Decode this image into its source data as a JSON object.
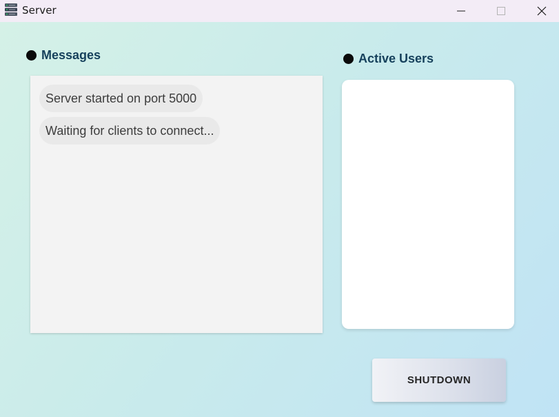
{
  "window": {
    "title": "Server",
    "app_icon": "server-rack-icon",
    "controls": {
      "minimize_icon": "minimize-icon",
      "maximize_icon": "maximize-icon",
      "close_icon": "close-icon"
    }
  },
  "messages": {
    "header": "Messages",
    "items": [
      {
        "text": "Server started on port 5000"
      },
      {
        "text": "Waiting for clients to connect..."
      }
    ]
  },
  "active_users": {
    "header": "Active Users",
    "items": []
  },
  "actions": {
    "shutdown_label": "SHUTDOWN"
  },
  "colors": {
    "header_text": "#16415c",
    "bullet": "#0a0a0a",
    "gradient_start": "#d5f1e7",
    "gradient_end": "#c0e3f5"
  }
}
